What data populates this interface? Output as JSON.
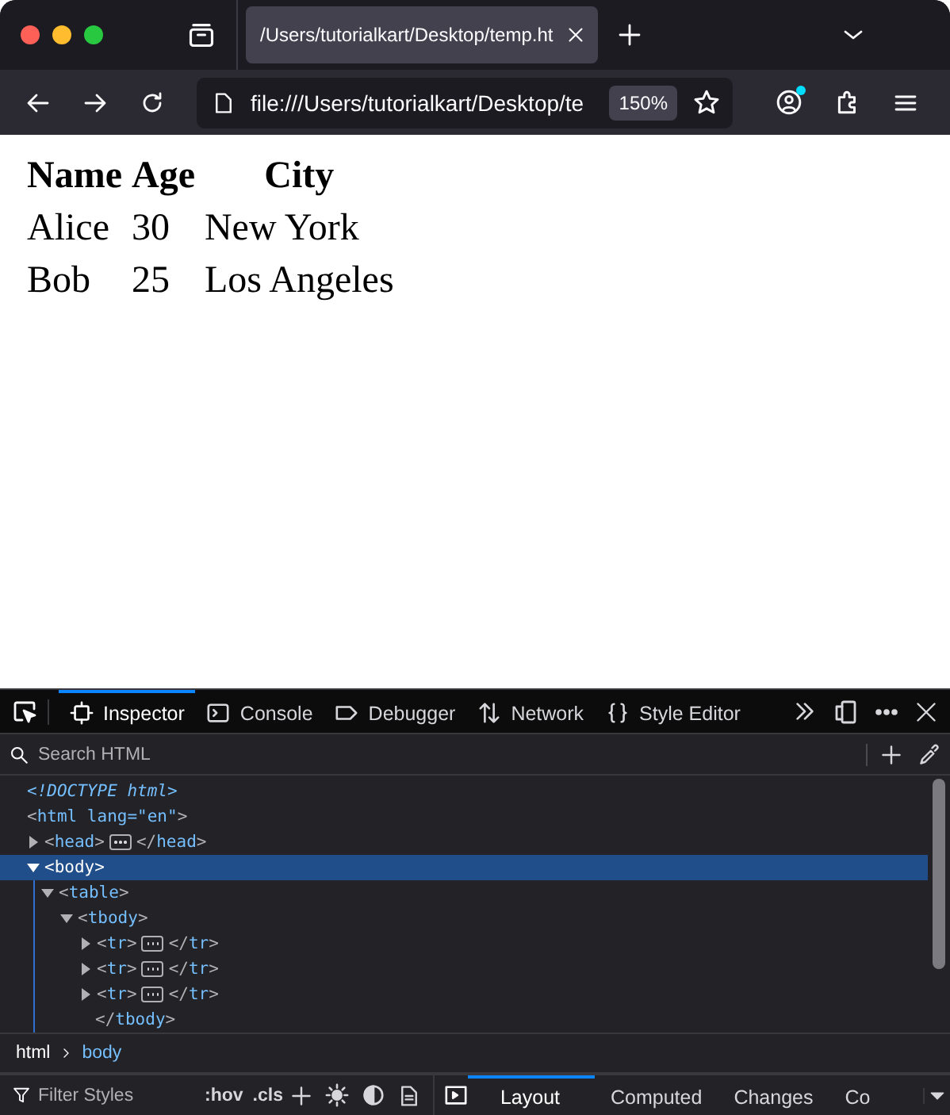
{
  "browser": {
    "tab": {
      "title": "/Users/tutorialkart/Desktop/temp.ht",
      "selected": true
    },
    "address": "file:///Users/tutorialkart/Desktop/te",
    "zoom": "150%"
  },
  "page": {
    "table": {
      "columns": [
        "Name",
        "Age",
        "City"
      ],
      "rows": [
        [
          "Alice",
          "30",
          "New York"
        ],
        [
          "Bob",
          "25",
          "Los Angeles"
        ]
      ]
    }
  },
  "devtools": {
    "tabs": [
      {
        "label": "Inspector",
        "kind": "inspector",
        "selected": true
      },
      {
        "label": "Console",
        "kind": "console",
        "selected": false
      },
      {
        "label": "Debugger",
        "kind": "debugger",
        "selected": false
      },
      {
        "label": "Network",
        "kind": "network",
        "selected": false
      },
      {
        "label": "Style Editor",
        "kind": "style",
        "selected": false
      }
    ],
    "search": {
      "placeholder": "Search HTML"
    },
    "markup": [
      {
        "kind": "doctype",
        "text": "<!DOCTYPE html>"
      },
      {
        "kind": "element",
        "open": "<html lang=\"en\">"
      },
      {
        "kind": "element",
        "open": "<head>",
        "close": "</head>",
        "expanded": false,
        "selected": false
      },
      {
        "kind": "element",
        "open": "<body>",
        "expanded": true,
        "selected": true,
        "children": [
          {
            "kind": "element",
            "open": "<table>",
            "expanded": true,
            "selected": false,
            "children": [
              {
                "kind": "element",
                "open": "<tbody>",
                "close": "</tbody>",
                "expanded": true,
                "selected": false,
                "children": [
                  {
                    "kind": "element",
                    "open": "<tr>",
                    "close": "</tr>",
                    "expanded": false,
                    "selected": false
                  },
                  {
                    "kind": "element",
                    "open": "<tr>",
                    "close": "</tr>",
                    "expanded": false,
                    "selected": false
                  },
                  {
                    "kind": "element",
                    "open": "<tr>",
                    "close": "</tr>",
                    "expanded": false,
                    "selected": false
                  }
                ]
              }
            ]
          }
        ]
      }
    ],
    "breadcrumbs": [
      {
        "label": "html",
        "selected": false
      },
      {
        "label": "body",
        "selected": true
      }
    ],
    "styles_filter": {
      "placeholder": "Filter Styles"
    },
    "style_toggles": [
      ":hov",
      ".cls"
    ],
    "sidebar_tabs": [
      {
        "label": "Layout",
        "selected": true
      },
      {
        "label": "Computed",
        "selected": false
      },
      {
        "label": "Changes",
        "selected": false
      },
      {
        "label": "Co",
        "selected": false
      }
    ]
  }
}
